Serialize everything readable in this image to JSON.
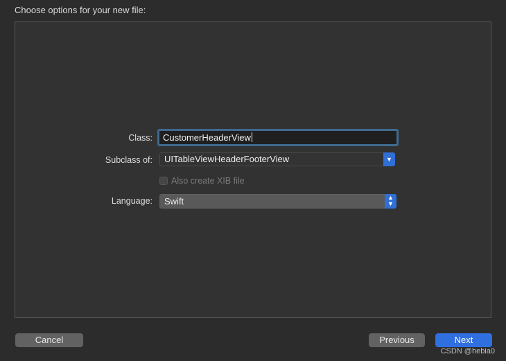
{
  "heading": "Choose options for your new file:",
  "form": {
    "class_label": "Class:",
    "class_value": "CustomerHeaderView",
    "subclass_label": "Subclass of:",
    "subclass_value": "UITableViewHeaderFooterView",
    "xib_label": "Also create XIB file",
    "xib_checked": false,
    "language_label": "Language:",
    "language_value": "Swift"
  },
  "buttons": {
    "cancel": "Cancel",
    "previous": "Previous",
    "next": "Next"
  },
  "watermark": "CSDN @hebia0",
  "colors": {
    "accent": "#2f6fe0",
    "focus_ring": "#3f6a8f"
  }
}
